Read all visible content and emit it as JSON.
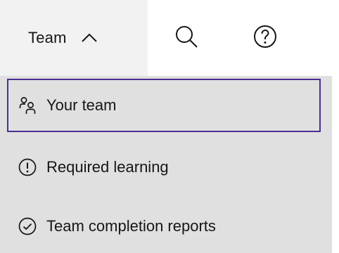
{
  "header": {
    "team_label": "Team",
    "icons": [
      "chevron-up-icon",
      "search-icon",
      "help-icon"
    ]
  },
  "menu": {
    "items": [
      {
        "label": "Your team",
        "icon": "user-group-icon",
        "selected": true
      },
      {
        "label": "Required learning",
        "icon": "warning-circle-icon",
        "selected": false
      },
      {
        "label": "Team completion reports",
        "icon": "checkmark-circle-icon",
        "selected": false
      }
    ]
  },
  "colors": {
    "header_tab_bg": "#f2f2f2",
    "menu_bg": "#e0e0e0",
    "focus_outline": "#4d2e91",
    "text": "#161616"
  }
}
